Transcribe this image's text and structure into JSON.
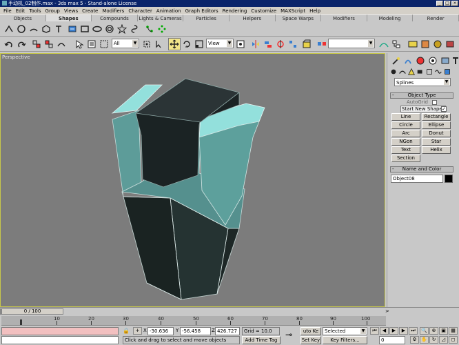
{
  "window": {
    "title": "手动机_02制作.max - 3ds max 5 - Stand-alone License"
  },
  "menu": [
    "File",
    "Edit",
    "Tools",
    "Group",
    "Views",
    "Create",
    "Modifiers",
    "Character",
    "Animation",
    "Graph Editors",
    "Rendering",
    "Customize",
    "MAXScript",
    "Help"
  ],
  "tabs": [
    "Objects",
    "Shapes",
    "Compounds",
    "Lights & Cameras",
    "Particles",
    "Helpers",
    "Space Warps",
    "Modifiers",
    "Modeling",
    "Render"
  ],
  "active_tab": "Shapes",
  "toolbar": {
    "selection_filter": "All",
    "ref_coord": "View",
    "named_sel": ""
  },
  "viewport": {
    "label": "Perspective"
  },
  "command_panel": {
    "category": "Splines",
    "object_type_title": "Object Type",
    "autogrid_label": "AutoGrid",
    "start_new_shape_label": "Start New Shape",
    "buttons": [
      "Line",
      "Rectangle",
      "Circle",
      "Ellipse",
      "Arc",
      "Donut",
      "NGon",
      "Star",
      "Text",
      "Helix",
      "Section"
    ],
    "name_color_title": "Name and Color",
    "object_name": "Object08",
    "object_color": "#000000"
  },
  "timeline": {
    "slider": "0 / 100",
    "ticks": [
      "10",
      "20",
      "30",
      "40",
      "50",
      "60",
      "70",
      "80",
      "90",
      "100"
    ]
  },
  "status": {
    "x_label": "X",
    "x_value": "-30.636",
    "y_label": "Y",
    "y_value": "-56.458",
    "z_label": "Z",
    "z_value": "426.727",
    "grid": "Grid = 10.0",
    "prompt": "Click and drag to select and move objects",
    "add_time_tag": "Add Time Tag",
    "auto_key": "uto Ke",
    "set_key": "Set Key",
    "key_mode": "Selected",
    "key_filters": "Key Filters...",
    "frame": "0"
  }
}
